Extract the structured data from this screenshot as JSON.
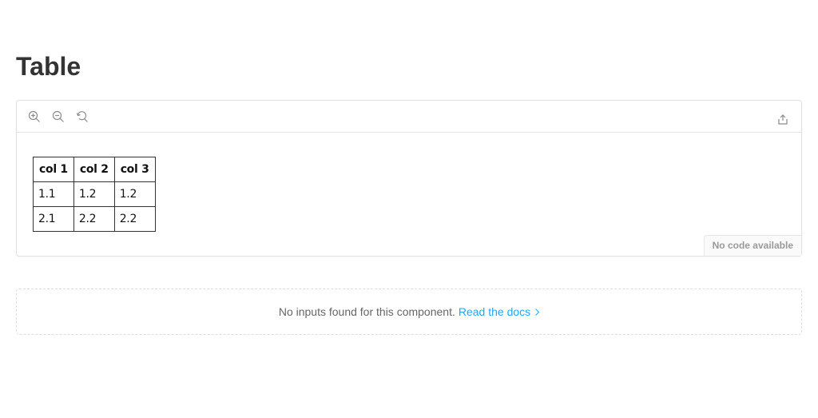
{
  "page": {
    "title": "Table"
  },
  "toolbar": {
    "icons": [
      "zoom-in-icon",
      "zoom-out-icon",
      "reset-zoom-icon",
      "share-icon"
    ]
  },
  "table": {
    "headers": [
      "col 1",
      "col 2",
      "col 3"
    ],
    "rows": [
      [
        "1.1",
        "1.2",
        "1.2"
      ],
      [
        "2.1",
        "2.2",
        "2.2"
      ]
    ]
  },
  "preview": {
    "no_code_label": "No code available"
  },
  "inputs": {
    "message": "No inputs found for this component.",
    "docs_link": "Read the docs"
  },
  "colors": {
    "link": "#1ea7fd",
    "text": "#333333",
    "muted": "#999999"
  }
}
